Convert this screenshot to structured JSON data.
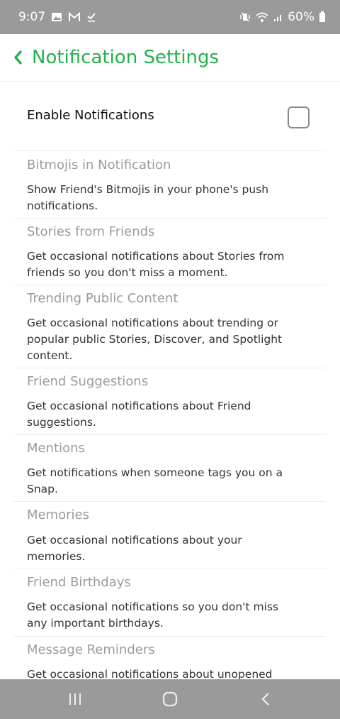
{
  "status_bar": {
    "time": "9:07",
    "battery": "60%",
    "left_icons": [
      "gallery-icon",
      "gmail-icon",
      "download-done-icon"
    ],
    "right_icons": [
      "vibrate-icon",
      "wifi-icon",
      "signal-icon",
      "battery-icon"
    ]
  },
  "header": {
    "title": "Notification Settings",
    "accent_color": "#23b14d"
  },
  "enable": {
    "label": "Enable Notifications",
    "checked": false
  },
  "settings": [
    {
      "title": "Bitmojis in Notification",
      "desc": "Show Friend's Bitmojis in your phone's push notifications."
    },
    {
      "title": "Stories from Friends",
      "desc": "Get occasional notifications about Stories from friends so you don't miss a moment."
    },
    {
      "title": "Trending Public Content",
      "desc": "Get occasional notifications about trending or popular public Stories, Discover, and Spotlight content."
    },
    {
      "title": "Friend Suggestions",
      "desc": "Get occasional notifications about Friend suggestions."
    },
    {
      "title": "Mentions",
      "desc": "Get notifications when someone tags you on a Snap."
    },
    {
      "title": "Memories",
      "desc": "Get occasional notifications about your memories."
    },
    {
      "title": "Friend Birthdays",
      "desc": "Get occasional notifications so you don't miss any important birthdays."
    },
    {
      "title": "Message Reminders",
      "desc": "Get occasional notifications about unopened"
    }
  ],
  "nav_bar": {
    "icons": [
      "recent-apps-icon",
      "home-icon",
      "back-icon"
    ]
  }
}
